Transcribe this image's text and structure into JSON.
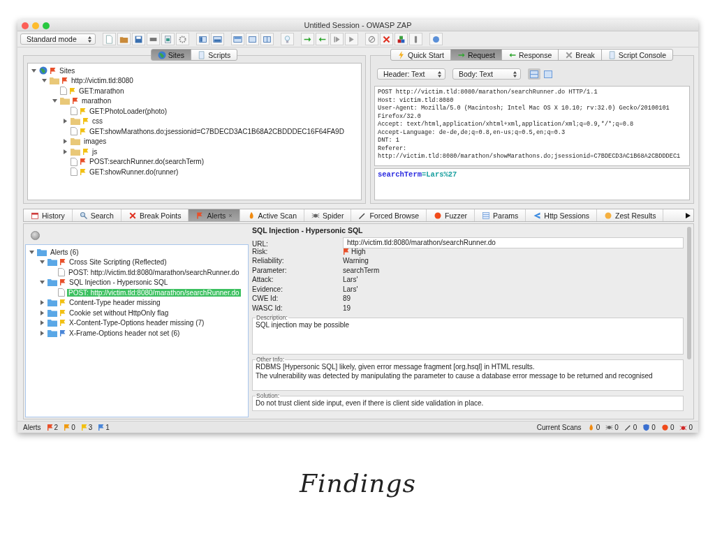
{
  "window": {
    "title": "Untitled Session - OWASP ZAP"
  },
  "toolbar": {
    "mode": "Standard mode"
  },
  "sites_tabs": [
    {
      "label": "Sites",
      "selected": true
    },
    {
      "label": "Scripts",
      "selected": false
    }
  ],
  "sites_tree": [
    {
      "label": "Sites",
      "kind": "globe",
      "color": "#e8502a",
      "expanded": true,
      "children": [
        {
          "label": "http://victim.tld:8080",
          "kind": "folder",
          "color": "#e8502a",
          "expanded": true,
          "children": [
            {
              "label": "GET:marathon",
              "kind": "page",
              "color": "#f2c012"
            },
            {
              "label": "marathon",
              "kind": "folder",
              "color": "#e8502a",
              "expanded": true,
              "children": [
                {
                  "label": "GET:PhotoLoader(photo)",
                  "kind": "page",
                  "color": "#f2c012"
                },
                {
                  "label": "css",
                  "kind": "folder",
                  "color": "#f2c012",
                  "expanded": false
                },
                {
                  "label": "GET:showMarathons.do;jsessionid=C7BDECD3AC1B68A2CBDDDEC16F64FA9D",
                  "kind": "page",
                  "color": "#f2c012"
                },
                {
                  "label": "images",
                  "kind": "folder",
                  "expanded": false
                },
                {
                  "label": "js",
                  "kind": "folder",
                  "color": "#f2c012",
                  "expanded": false
                },
                {
                  "label": "POST:searchRunner.do(searchTerm)",
                  "kind": "page",
                  "color": "#e8502a"
                },
                {
                  "label": "GET:showRunner.do(runner)",
                  "kind": "page",
                  "color": "#f2c012"
                }
              ]
            }
          ]
        }
      ]
    }
  ],
  "request_tabs": [
    {
      "label": "Quick Start",
      "selected": false
    },
    {
      "label": "Request",
      "selected": true
    },
    {
      "label": "Response",
      "selected": false
    },
    {
      "label": "Break",
      "selected": false
    },
    {
      "label": "Script Console",
      "selected": false
    }
  ],
  "request_view": {
    "header_format": "Header: Text",
    "body_format": "Body: Text",
    "layouts": [
      {
        "selected": true
      },
      {
        "selected": false
      }
    ],
    "header_lines": [
      "POST http://victim.tld:8080/marathon/searchRunner.do HTTP/1.1",
      "Host: victim.tld:8080",
      "User-Agent: Mozilla/5.0 (Macintosh; Intel Mac OS X 10.10; rv:32.0) Gecko/20100101",
      "Firefox/32.0",
      "Accept: text/html,application/xhtml+xml,application/xml;q=0.9,*/*;q=0.8",
      "Accept-Language: de-de,de;q=0.8,en-us;q=0.5,en;q=0.3",
      "DNT: 1",
      "Referer:",
      "http://victim.tld:8080/marathon/showMarathons.do;jsessionid=C7BDECD3AC1B68A2CBDDDEC1"
    ],
    "body": [
      {
        "text": "searchTerm",
        "color": "#2a2ae0"
      },
      {
        "text": "=Lars%27",
        "color": "#1aa0a0"
      }
    ]
  },
  "bottom_tabs": [
    {
      "label": "History",
      "selected": false
    },
    {
      "label": "Search",
      "selected": false
    },
    {
      "label": "Break Points",
      "selected": false
    },
    {
      "label": "Alerts",
      "selected": true,
      "close": "×"
    },
    {
      "label": "Active Scan",
      "selected": false
    },
    {
      "label": "Spider",
      "selected": false
    },
    {
      "label": "Forced Browse",
      "selected": false
    },
    {
      "label": "Fuzzer",
      "selected": false
    },
    {
      "label": "Params",
      "selected": false
    },
    {
      "label": "Http Sessions",
      "selected": false
    },
    {
      "label": "Zest Results",
      "selected": false
    }
  ],
  "alerts_tree": [
    {
      "label": "Alerts (6)",
      "kind": "folder",
      "expanded": true,
      "selected": false,
      "children": [
        {
          "label": "Cross Site Scripting (Reflected)",
          "kind": "folder",
          "color": "#e8502a",
          "expanded": true,
          "selected": false,
          "children": [
            {
              "label": "POST: http://victim.tld:8080/marathon/searchRunner.do",
              "kind": "page",
              "selected": false
            }
          ]
        },
        {
          "label": "SQL Injection - Hypersonic SQL",
          "kind": "folder",
          "color": "#e8502a",
          "expanded": true,
          "selected": false,
          "children": [
            {
              "label": "POST: http://victim.tld:8080/marathon/searchRunner.do",
              "kind": "page",
              "selected": true
            }
          ]
        },
        {
          "label": "Content-Type header missing",
          "kind": "folder",
          "color": "#f2c012",
          "expanded": false,
          "selected": false
        },
        {
          "label": "Cookie set without HttpOnly flag",
          "kind": "folder",
          "color": "#f2c012",
          "expanded": false,
          "selected": false
        },
        {
          "label": "X-Content-Type-Options header missing (7)",
          "kind": "folder",
          "color": "#f2c012",
          "expanded": false,
          "selected": false
        },
        {
          "label": "X-Frame-Options header not set (6)",
          "kind": "folder",
          "color": "#4a86d8",
          "expanded": false,
          "selected": false
        }
      ]
    }
  ],
  "alert_detail": {
    "title": "SQL Injection - Hypersonic SQL",
    "url_label": "URL:",
    "url": "http://victim.tld:8080/marathon/searchRunner.do",
    "fields": [
      {
        "label": "Risk:",
        "value": "High",
        "color": "#e8502a"
      },
      {
        "label": "Reliability:",
        "value": "Warning"
      },
      {
        "label": "Parameter:",
        "value": "searchTerm"
      },
      {
        "label": "Attack:",
        "value": "Lars'"
      },
      {
        "label": "Evidence:",
        "value": "Lars'"
      },
      {
        "label": "CWE Id:",
        "value": "89"
      },
      {
        "label": "WASC Id:",
        "value": "19"
      }
    ],
    "sections": [
      {
        "title": "Description:",
        "lines": [
          "SQL injection may be possible"
        ]
      },
      {
        "title": "Other Info:",
        "lines": [
          "RDBMS [Hypersonic SQL] likely, given error message fragment [org.hsql] in HTML results.",
          "The vulnerability was detected by manipulating the parameter to cause a database error message to be returned and recognised"
        ]
      },
      {
        "title": "Solution:",
        "lines": [
          "Do not trust client side input, even if there is client side validation in place."
        ]
      }
    ]
  },
  "status_bar": {
    "alerts_label": "Alerts",
    "alert_counts": [
      {
        "color": "#e8502a",
        "count": "2"
      },
      {
        "color": "#f09a10",
        "count": "0"
      },
      {
        "color": "#f2c012",
        "count": "3"
      },
      {
        "color": "#4a86d8",
        "count": "1"
      }
    ],
    "scans_label": "Current Scans",
    "scans": [
      {
        "kind": "active",
        "count": "0"
      },
      {
        "kind": "spider",
        "count": "0"
      },
      {
        "kind": "forced",
        "count": "0"
      },
      {
        "kind": "shield",
        "count": "0"
      },
      {
        "kind": "fuzzer",
        "count": "0"
      },
      {
        "kind": "bug",
        "count": "0"
      }
    ]
  },
  "caption": "Findings"
}
